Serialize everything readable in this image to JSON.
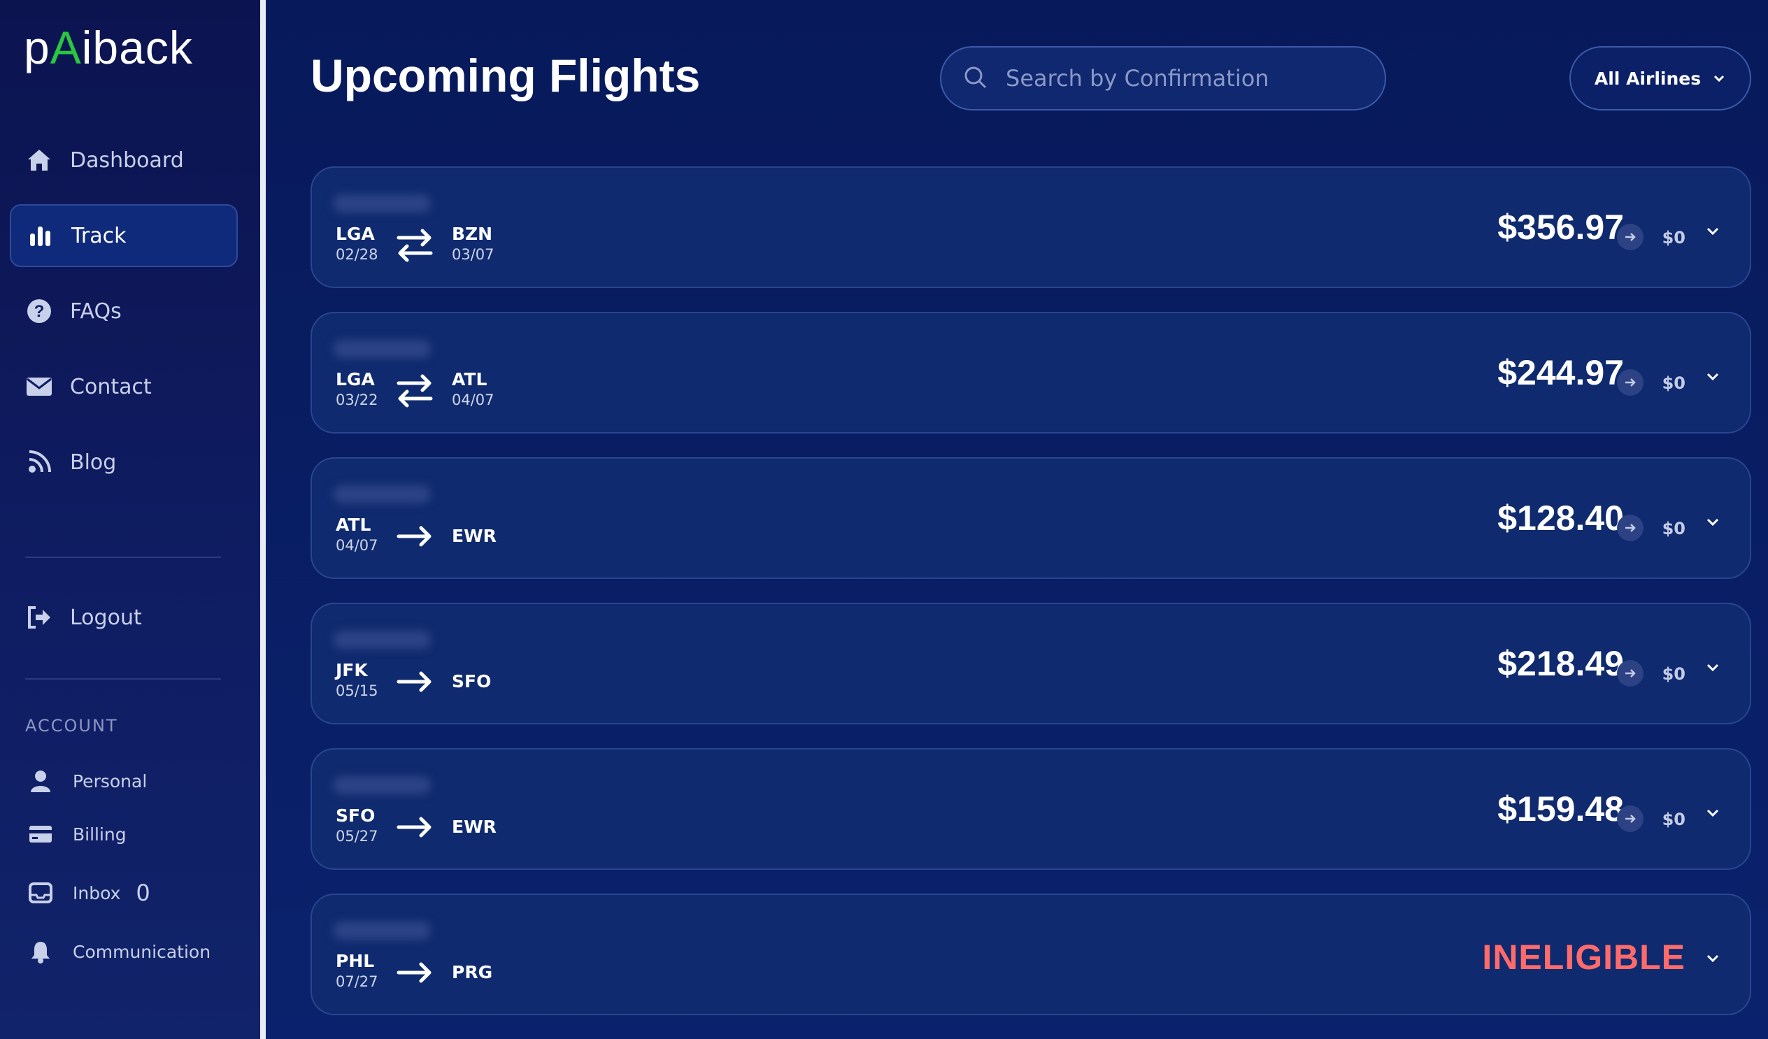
{
  "app": {
    "logo_part1": "p",
    "logo_accent": "A",
    "logo_part2": "i",
    "logo_part3": "back"
  },
  "sidebar": {
    "items": [
      {
        "label": "Dashboard",
        "icon": "home-icon"
      },
      {
        "label": "Track",
        "icon": "chart-bar-icon",
        "active": true
      },
      {
        "label": "FAQs",
        "icon": "question-circle-icon"
      },
      {
        "label": "Contact",
        "icon": "envelope-icon"
      },
      {
        "label": "Blog",
        "icon": "rss-icon"
      }
    ],
    "logout_label": "Logout",
    "account_label": "ACCOUNT",
    "account_items": [
      {
        "label": "Personal",
        "icon": "user-icon"
      },
      {
        "label": "Billing",
        "icon": "credit-card-icon"
      },
      {
        "label": "Inbox",
        "icon": "inbox-icon",
        "count": "0"
      },
      {
        "label": "Communication",
        "icon": "bell-icon"
      }
    ]
  },
  "header": {
    "title": "Upcoming Flights",
    "search_placeholder": "Search by Confirmation",
    "airline_filter": "All Airlines"
  },
  "flights": [
    {
      "from": "LGA",
      "from_date": "02/28",
      "to": "BZN",
      "to_date": "03/07",
      "round_trip": true,
      "price": "$356.97",
      "refund": "$0"
    },
    {
      "from": "LGA",
      "from_date": "03/22",
      "to": "ATL",
      "to_date": "04/07",
      "round_trip": true,
      "price": "$244.97",
      "refund": "$0"
    },
    {
      "from": "ATL",
      "from_date": "04/07",
      "to": "EWR",
      "to_date": "",
      "round_trip": false,
      "price": "$128.40",
      "refund": "$0"
    },
    {
      "from": "JFK",
      "from_date": "05/15",
      "to": "SFO",
      "to_date": "",
      "round_trip": false,
      "price": "$218.49",
      "refund": "$0"
    },
    {
      "from": "SFO",
      "from_date": "05/27",
      "to": "EWR",
      "to_date": "",
      "round_trip": false,
      "price": "$159.48",
      "refund": "$0"
    },
    {
      "from": "PHL",
      "from_date": "07/27",
      "to": "PRG",
      "to_date": "",
      "round_trip": false,
      "status": "INELIGIBLE"
    }
  ],
  "colors": {
    "accent": "#28c840",
    "ineligible": "#ff6b6b",
    "background": "#061a5e"
  }
}
